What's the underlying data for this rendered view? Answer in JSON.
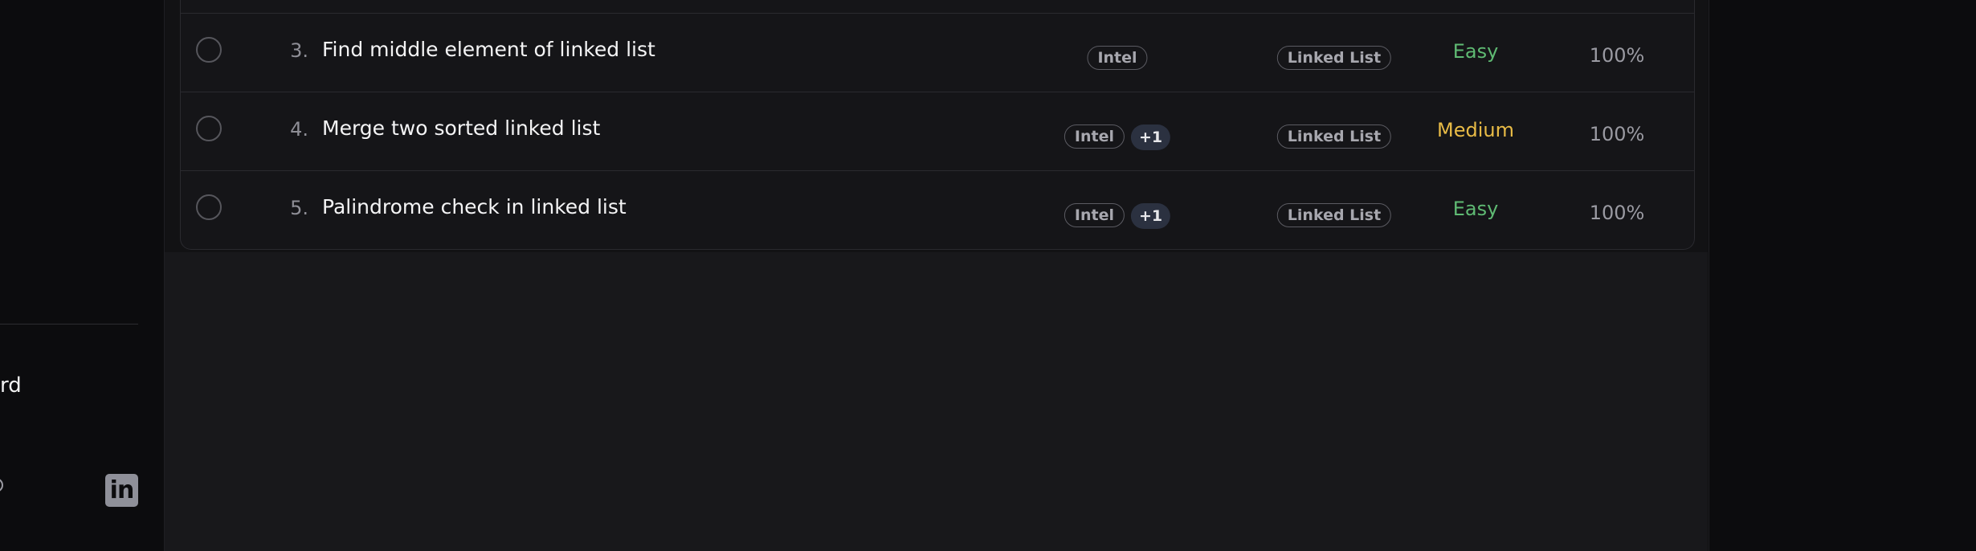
{
  "sidebar": {
    "item_text": "rd",
    "icons": [
      "partial-circle-icon",
      "linkedin-icon"
    ],
    "linkedin_glyph": "in"
  },
  "colors": {
    "easy": "#5fba73",
    "medium": "#e8bb46"
  },
  "problems": [
    {
      "number": "3.",
      "title": "Find middle element of linked list",
      "company": "Intel",
      "extra_companies": "",
      "topic": "Linked List",
      "difficulty": "Easy",
      "acceptance": "100%"
    },
    {
      "number": "4.",
      "title": "Merge two sorted linked list",
      "company": "Intel",
      "extra_companies": "+1",
      "topic": "Linked List",
      "difficulty": "Medium",
      "acceptance": "100%"
    },
    {
      "number": "5.",
      "title": "Palindrome check in linked list",
      "company": "Intel",
      "extra_companies": "+1",
      "topic": "Linked List",
      "difficulty": "Easy",
      "acceptance": "100%"
    }
  ]
}
